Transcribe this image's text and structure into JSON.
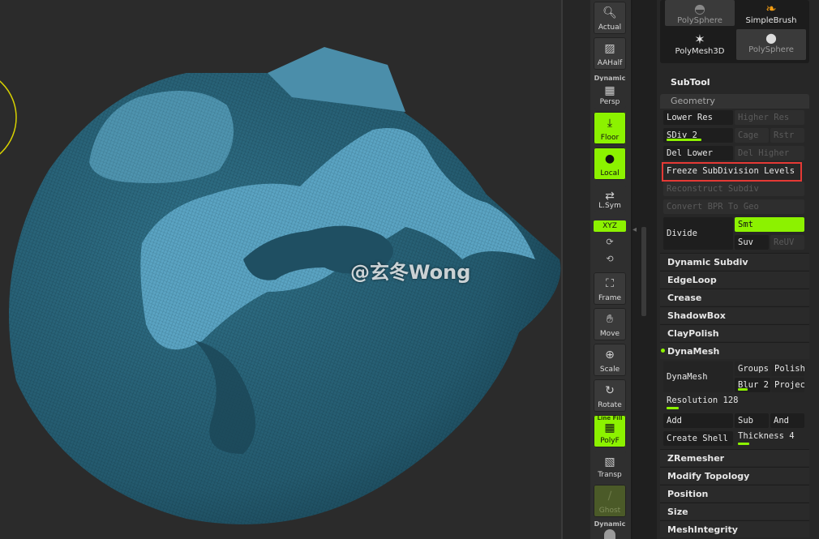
{
  "watermark": "@玄冬Wong",
  "shelf": {
    "actual": "Actual",
    "aahalf": "AAHalf",
    "dynamic_top": "Dynamic",
    "persp": "Persp",
    "floor": "Floor",
    "local": "Local",
    "lsym": "L.Sym",
    "xyz": "XYZ",
    "frame": "Frame",
    "move": "Move",
    "scale": "Scale",
    "rotate": "Rotate",
    "polyf_top": "Line Fill",
    "polyf": "PolyF",
    "transp": "Transp",
    "ghost": "Ghost",
    "dynamic_bottom": "Dynamic"
  },
  "brushes": {
    "polysphere_top": "PolySphere",
    "simplebrush": "SimpleBrush",
    "polymesh3d": "PolyMesh3D",
    "polysphere": "PolySphere"
  },
  "subtool_label": "SubTool",
  "geometry": {
    "header": "Geometry",
    "lower_res": "Lower Res",
    "higher_res": "Higher Res",
    "sdiv": "SDiv 2",
    "sdiv_fill": 0.55,
    "cage": "Cage",
    "rstr": "Rstr",
    "del_lower": "Del Lower",
    "del_higher": "Del Higher",
    "freeze": "Freeze SubDivision Levels",
    "reconstruct": "Reconstruct Subdiv",
    "convert_bpr": "Convert BPR To Geo",
    "divide": "Divide",
    "smt": "Smt",
    "suv": "Suv",
    "reuv": "ReUV"
  },
  "sections": {
    "dynamic_subdiv": "Dynamic Subdiv",
    "edgeloop": "EdgeLoop",
    "crease": "Crease",
    "shadowbox": "ShadowBox",
    "claypolish": "ClayPolish",
    "dynamesh": "DynaMesh",
    "zremesher": "ZRemesher",
    "modify_topology": "Modify Topology",
    "position": "Position",
    "size": "Size",
    "meshintegrity": "MeshIntegrity"
  },
  "dynamesh": {
    "button": "DynaMesh",
    "groups": "Groups",
    "polish": "Polish",
    "blur": "Blur 2",
    "projec": "Projec",
    "resolution": "Resolution 128",
    "add": "Add",
    "sub": "Sub",
    "and": "And",
    "create_shell": "Create Shell",
    "thickness": "Thickness 4"
  },
  "colors": {
    "accent": "#8cf200",
    "highlight": "#e53935",
    "mesh": "#2f6f86"
  }
}
